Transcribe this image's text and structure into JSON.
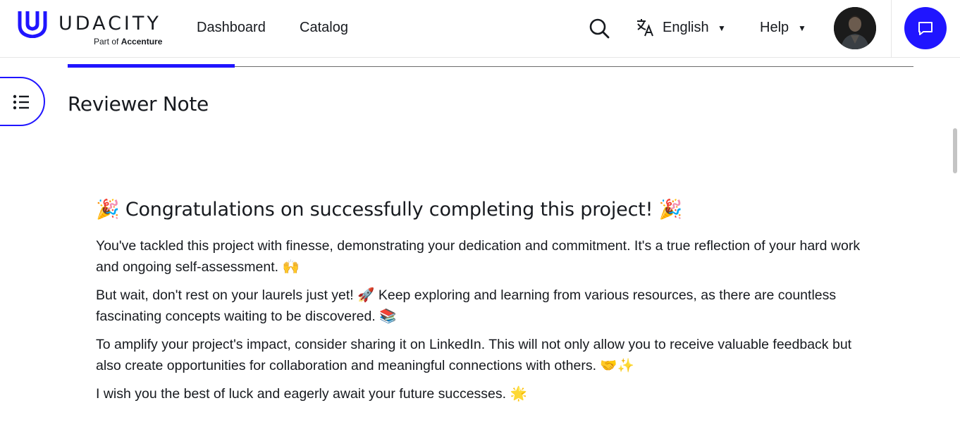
{
  "header": {
    "logo_word": "UDACITY",
    "logo_sub_prefix": "Part of",
    "logo_sub_brand": "Accenture",
    "nav": {
      "dashboard": "Dashboard",
      "catalog": "Catalog"
    },
    "language": "English",
    "help": "Help",
    "icons": {
      "search": "search-icon",
      "translate": "translate-icon",
      "chat": "chat-icon",
      "caret": "caret-down-icon"
    }
  },
  "progress": {
    "completed_fraction": 0.2
  },
  "page": {
    "title": "Reviewer Note"
  },
  "note": {
    "heading_emoji": "🎉",
    "heading": "Congratulations on successfully completing this project!",
    "paragraphs": [
      "You've tackled this project with finesse, demonstrating your dedication and commitment. It's a true reflection of your hard work and ongoing self-assessment. 🙌",
      "But wait, don't rest on your laurels just yet! 🚀 Keep exploring and learning from various resources, as there are countless fascinating concepts waiting to be discovered. 📚",
      "To amplify your project's impact, consider sharing it on LinkedIn. This will not only allow you to receive valuable feedback but also create opportunities for collaboration and meaningful connections with others. 🤝✨",
      "I wish you the best of luck and eagerly await your future successes. 🌟"
    ]
  },
  "colors": {
    "brand": "#2015ff",
    "text": "#171a1f",
    "divider": "#e6e6e6"
  }
}
